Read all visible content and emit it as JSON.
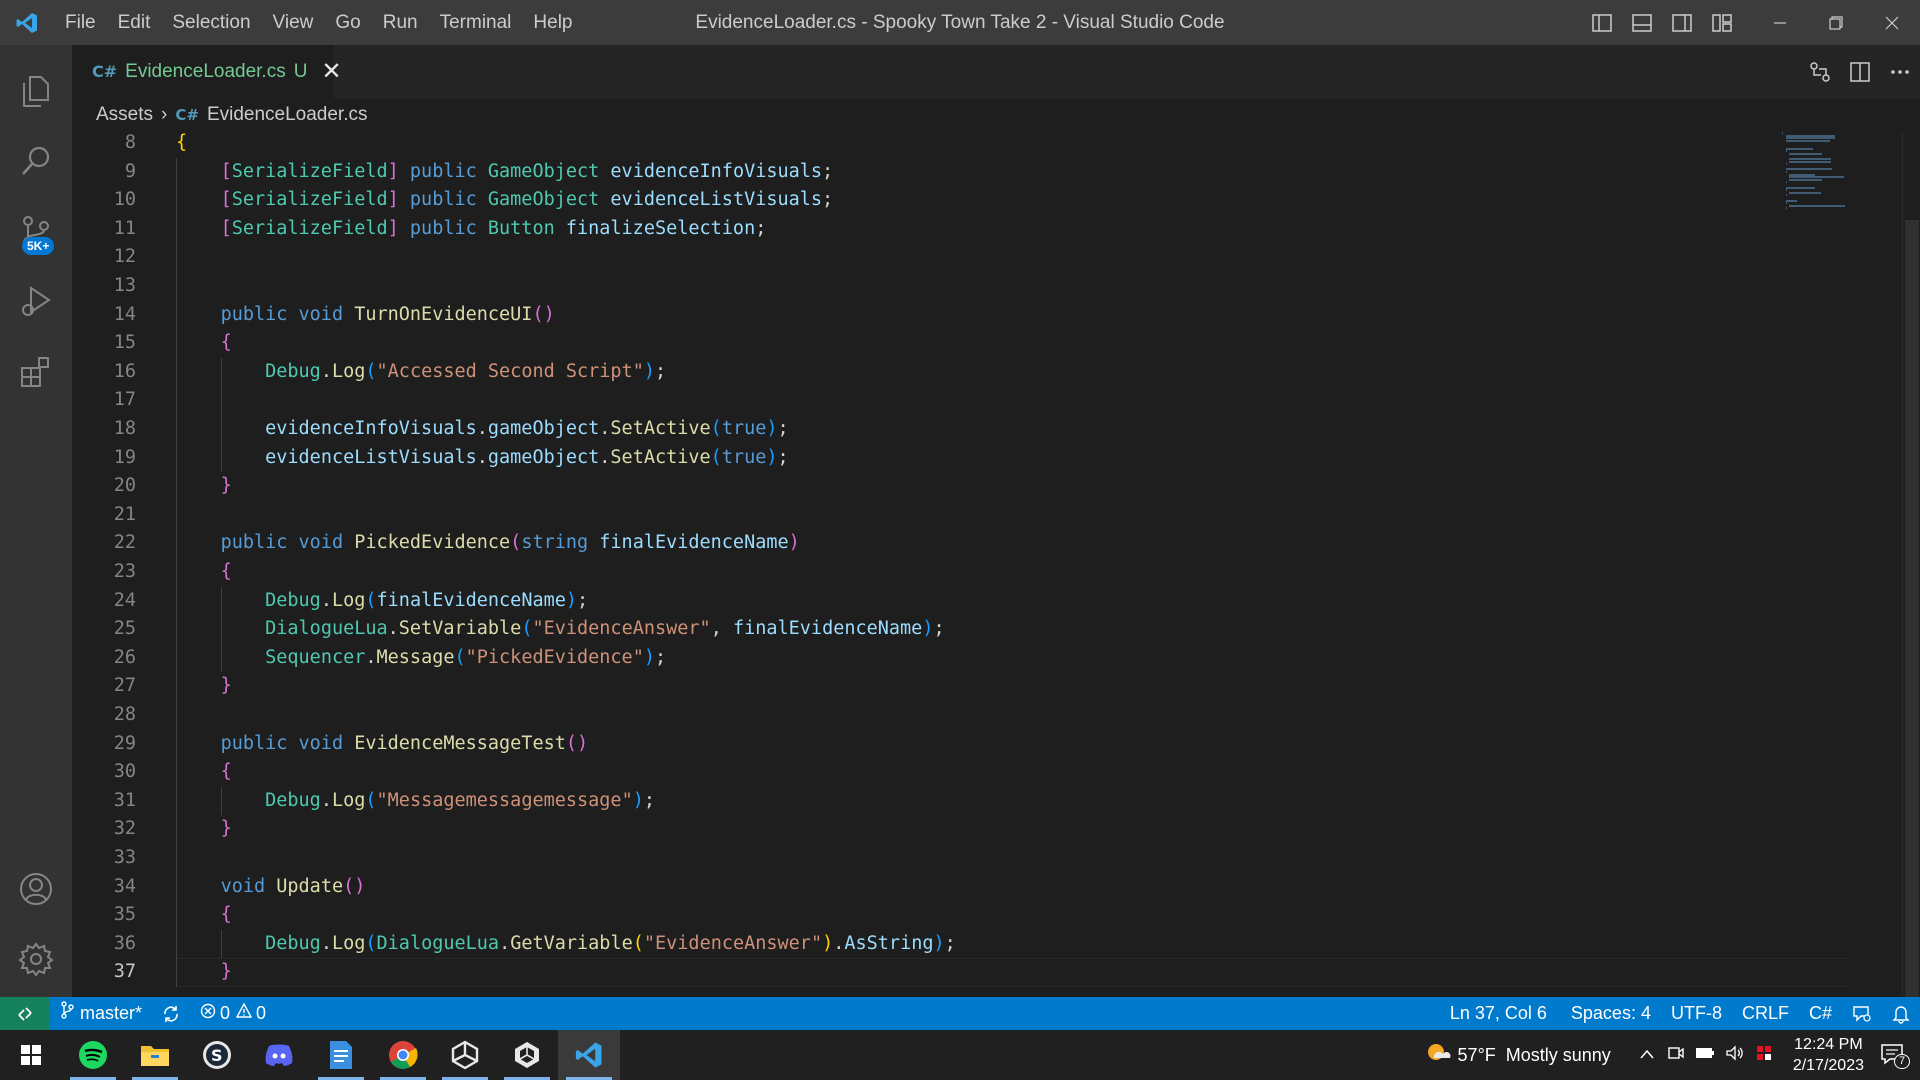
{
  "window": {
    "title": "EvidenceLoader.cs - Spooky Town Take 2 - Visual Studio Code",
    "menu": [
      "File",
      "Edit",
      "Selection",
      "View",
      "Go",
      "Run",
      "Terminal",
      "Help"
    ]
  },
  "activity_bar": {
    "items": [
      "explorer-icon",
      "search-icon",
      "source-control-icon",
      "run-debug-icon",
      "extensions-icon"
    ],
    "source_control_badge": "5K+",
    "bottom_items": [
      "accounts-icon",
      "settings-gear-icon"
    ]
  },
  "tab": {
    "icon": "C#",
    "label": "EvidenceLoader.cs",
    "status": "U",
    "close": "✕"
  },
  "breadcrumb": {
    "folder": "Assets",
    "icon": "C#",
    "file": "EvidenceLoader.cs"
  },
  "editor": {
    "active_line": 37,
    "lines": [
      {
        "n": "8",
        "code": "{"
      },
      {
        "n": "9",
        "code": "    [SerializeField] public GameObject evidenceInfoVisuals;"
      },
      {
        "n": "10",
        "code": "    [SerializeField] public GameObject evidenceListVisuals;"
      },
      {
        "n": "11",
        "code": "    [SerializeField] public Button finalizeSelection;"
      },
      {
        "n": "12",
        "code": ""
      },
      {
        "n": "13",
        "code": ""
      },
      {
        "n": "14",
        "code": "    public void TurnOnEvidenceUI()"
      },
      {
        "n": "15",
        "code": "    {"
      },
      {
        "n": "16",
        "code": "        Debug.Log(\"Accessed Second Script\");"
      },
      {
        "n": "17",
        "code": ""
      },
      {
        "n": "18",
        "code": "        evidenceInfoVisuals.gameObject.SetActive(true);"
      },
      {
        "n": "19",
        "code": "        evidenceListVisuals.gameObject.SetActive(true);"
      },
      {
        "n": "20",
        "code": "    }"
      },
      {
        "n": "21",
        "code": ""
      },
      {
        "n": "22",
        "code": "    public void PickedEvidence(string finalEvidenceName)"
      },
      {
        "n": "23",
        "code": "    {"
      },
      {
        "n": "24",
        "code": "        Debug.Log(finalEvidenceName);"
      },
      {
        "n": "25",
        "code": "        DialogueLua.SetVariable(\"EvidenceAnswer\", finalEvidenceName);"
      },
      {
        "n": "26",
        "code": "        Sequencer.Message(\"PickedEvidence\");"
      },
      {
        "n": "27",
        "code": "    }"
      },
      {
        "n": "28",
        "code": ""
      },
      {
        "n": "29",
        "code": "    public void EvidenceMessageTest()"
      },
      {
        "n": "30",
        "code": "    {"
      },
      {
        "n": "31",
        "code": "        Debug.Log(\"Messagemessagemessage\");"
      },
      {
        "n": "32",
        "code": "    }"
      },
      {
        "n": "33",
        "code": ""
      },
      {
        "n": "34",
        "code": "    void Update()"
      },
      {
        "n": "35",
        "code": "    {"
      },
      {
        "n": "36",
        "code": "        Debug.Log(DialogueLua.GetVariable(\"EvidenceAnswer\").AsString);"
      },
      {
        "n": "37",
        "code": "    }"
      }
    ]
  },
  "status_bar": {
    "branch": "master*",
    "errors": "0",
    "warnings": "0",
    "position": "Ln 37, Col 6",
    "spaces": "Spaces: 4",
    "encoding": "UTF-8",
    "eol": "CRLF",
    "language": "C#"
  },
  "taskbar": {
    "apps": [
      "windows-start-icon",
      "spotify-icon",
      "file-explorer-icon",
      "steam-icon",
      "discord-icon",
      "notepad-icon",
      "chrome-icon",
      "unity-icon",
      "unity-hub-icon",
      "vscode-icon"
    ],
    "weather": "57°F  Mostly sunny",
    "time": "12:24 PM",
    "date": "2/17/2023",
    "notifications": "7"
  },
  "colors": {
    "accent": "#007acc",
    "keyword": "#569cd6",
    "type": "#4ec9b0",
    "function": "#dcdcaa",
    "variable": "#9cdcfe",
    "string": "#ce9178"
  }
}
